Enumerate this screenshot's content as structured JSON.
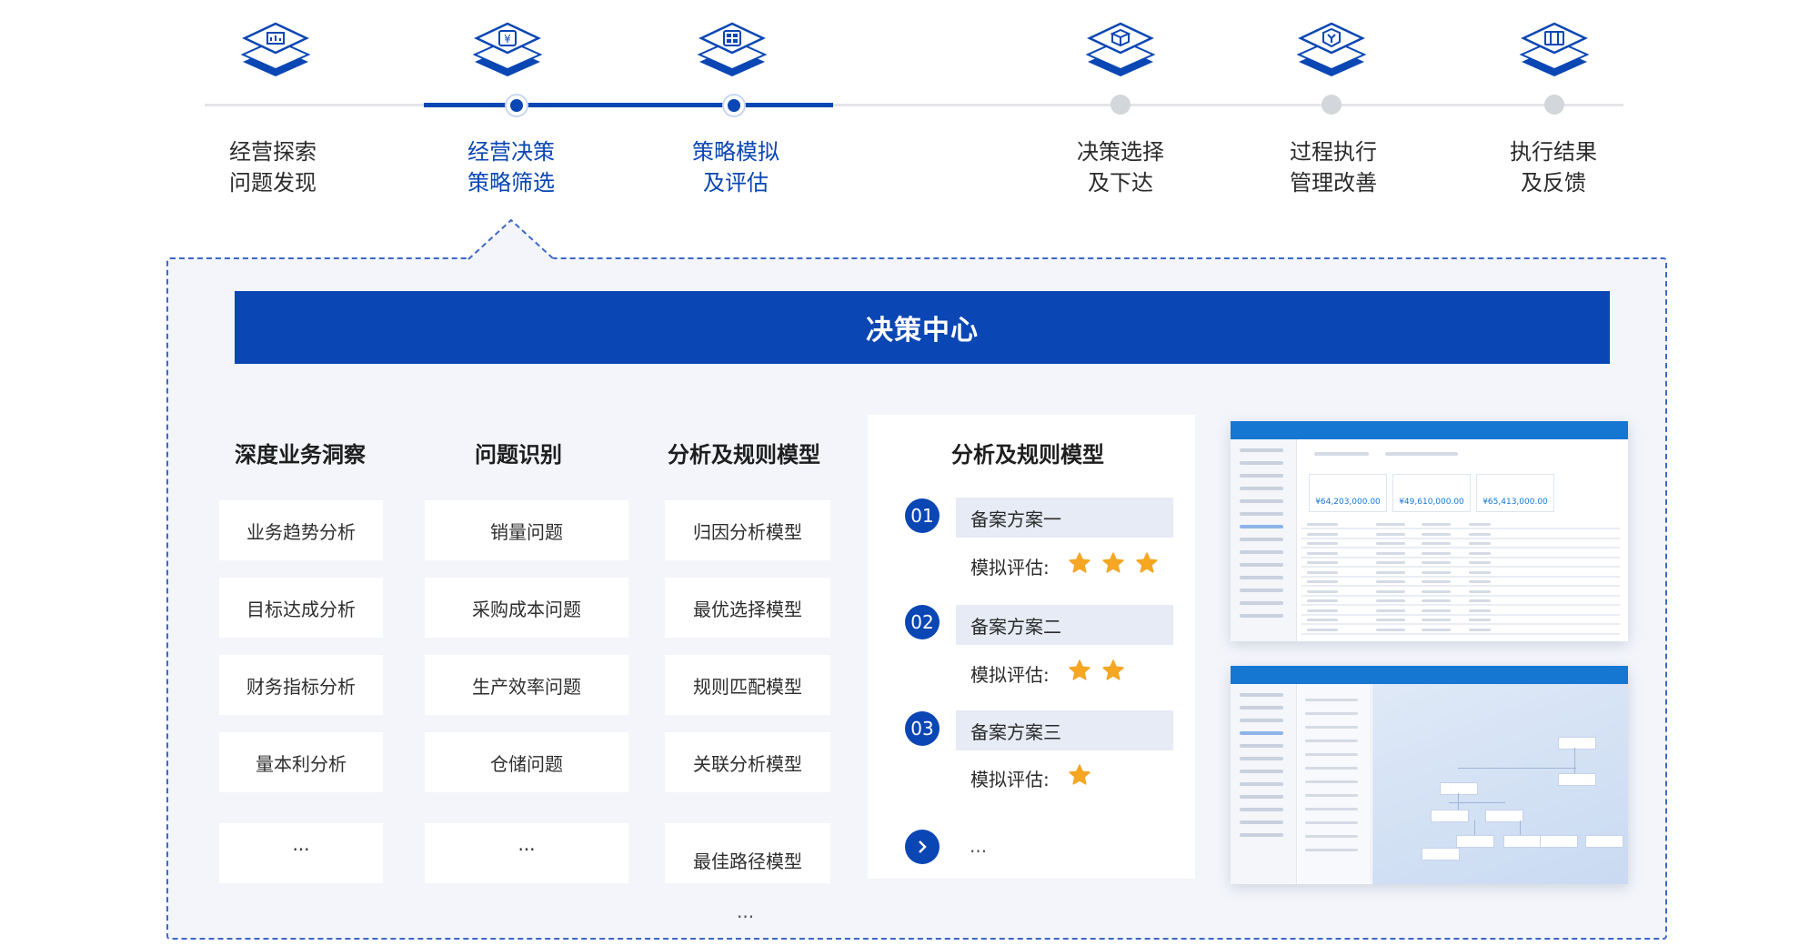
{
  "steps": [
    {
      "label": "经营探索\n问题发现",
      "icon": "chart-icon",
      "state": "inactive"
    },
    {
      "label": "经营决策\n策略筛选",
      "icon": "yuan-icon",
      "state": "active"
    },
    {
      "label": "策略模拟\n及评估",
      "icon": "grid-icon",
      "state": "active"
    },
    {
      "label": "决策选择\n及下达",
      "icon": "box-icon",
      "state": "inactive"
    },
    {
      "label": "过程执行\n管理改善",
      "icon": "filter-icon",
      "state": "inactive"
    },
    {
      "label": "执行结果\n及反馈",
      "icon": "book-icon",
      "state": "inactive"
    }
  ],
  "banner": "决策中心",
  "columns": [
    {
      "title": "深度业务洞察",
      "items": [
        "业务趋势分析",
        "目标达成分析",
        "财务指标分析",
        "量本利分析",
        "..."
      ]
    },
    {
      "title": "问题识别",
      "items": [
        "销量问题",
        "采购成本问题",
        "生产效率问题",
        "仓储问题",
        "..."
      ]
    },
    {
      "title": "分析及规则模型",
      "items": [
        "归因分析模型",
        "最优选择模型",
        "规则匹配模型",
        "关联分析模型",
        "最佳路径模型"
      ],
      "more": "..."
    }
  ],
  "panel": {
    "title": "分析及规则模型",
    "eval_label": "模拟评估:",
    "schemes": [
      {
        "num": "01",
        "name": "备案方案一",
        "stars": 3
      },
      {
        "num": "02",
        "name": "备案方案二",
        "stars": 2
      },
      {
        "num": "03",
        "name": "备案方案三",
        "stars": 1
      }
    ],
    "more": "..."
  },
  "shot1": {
    "kpis": [
      "¥64,203,000.00",
      "¥49,610,000.00",
      "¥65,413,000.00"
    ]
  },
  "colors": {
    "primary": "#0a46b4",
    "star": "#f5a623",
    "inactive_dot": "#d3d6db"
  }
}
